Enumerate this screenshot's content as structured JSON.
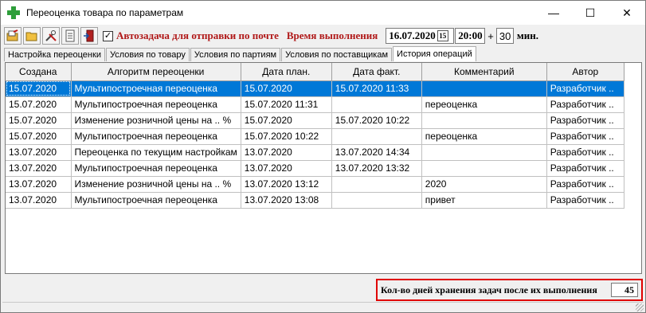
{
  "window": {
    "title": "Переоценка товара по параметрам",
    "controls": {
      "minimize": "—",
      "maximize": "☐",
      "close": "✕"
    }
  },
  "toolbar": {
    "icons": [
      "open-folder-icon",
      "folder-icon",
      "tools-icon",
      "document-icon",
      "exit-door-icon"
    ],
    "auto_task_checked": "✓",
    "auto_task_label": "Автозадача для отправки по почте",
    "exec_time_label": "Время выполнения",
    "date_value": "16.07.2020",
    "calendar_label": "15",
    "time_value": "20:00",
    "plus_label": "+",
    "minutes_value": "30",
    "minutes_unit": "мин."
  },
  "tabs": [
    {
      "label": "Настройка переоценки"
    },
    {
      "label": "Условия по товару"
    },
    {
      "label": "Условия по партиям"
    },
    {
      "label": "Условия по поставщикам"
    },
    {
      "label": "История операций"
    }
  ],
  "grid": {
    "columns": [
      "Создана",
      "Алгоритм переоценки",
      "Дата план.",
      "Дата факт.",
      "Комментарий",
      "Автор"
    ],
    "rows": [
      [
        "15.07.2020",
        "Мультипостроечная переоценка",
        "15.07.2020",
        "15.07.2020 11:33",
        "",
        "Разработчик .."
      ],
      [
        "15.07.2020",
        "Мультипостроечная переоценка",
        "15.07.2020 11:31",
        "",
        "переоценка",
        "Разработчик .."
      ],
      [
        "15.07.2020",
        "Изменение розничной цены на .. %",
        "15.07.2020",
        "15.07.2020 10:22",
        "",
        "Разработчик .."
      ],
      [
        "15.07.2020",
        "Мультипостроечная переоценка",
        "15.07.2020 10:22",
        "",
        "переоценка",
        "Разработчик .."
      ],
      [
        "13.07.2020",
        "Переоценка по текущим настройкам",
        "13.07.2020",
        "13.07.2020 14:34",
        "",
        "Разработчик .."
      ],
      [
        "13.07.2020",
        "Мультипостроечная переоценка",
        "13.07.2020",
        "13.07.2020 13:32",
        "",
        "Разработчик .."
      ],
      [
        "13.07.2020",
        "Изменение розничной цены на .. %",
        "13.07.2020 13:12",
        "",
        "2020",
        "Разработчик .."
      ],
      [
        "13.07.2020",
        "Мультипостроечная переоценка",
        "13.07.2020 13:08",
        "",
        "привет",
        "Разработчик .."
      ]
    ]
  },
  "footer": {
    "retention_label": "Кол-во дней хранения задач после их выполнения",
    "retention_days": "45"
  }
}
